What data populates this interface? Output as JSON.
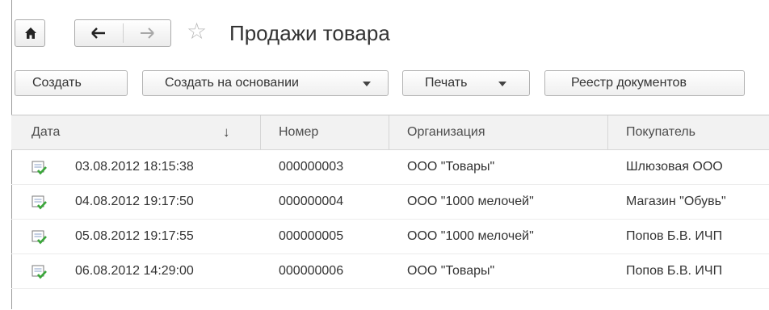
{
  "header": {
    "title": "Продажи товара",
    "home_icon": "home-icon",
    "back_icon": "arrow-left-icon",
    "forward_icon": "arrow-right-icon",
    "favorite_icon": "star-outline-icon"
  },
  "toolbar": {
    "create": "Создать",
    "create_based_on": "Создать на основании",
    "print": "Печать",
    "register": "Реестр документов"
  },
  "table": {
    "columns": [
      "Дата",
      "Номер",
      "Организация",
      "Покупатель"
    ],
    "sort_indicator": "↓",
    "rows": [
      {
        "date": "03.08.2012 18:15:38",
        "number": "000000003",
        "org": "ООО \"Товары\"",
        "buyer": "Шлюзовая ООО"
      },
      {
        "date": "04.08.2012 19:17:50",
        "number": "000000004",
        "org": "ООО \"1000 мелочей\"",
        "buyer": "Магазин \"Обувь\""
      },
      {
        "date": "05.08.2012 19:17:55",
        "number": "000000005",
        "org": "ООО \"1000 мелочей\"",
        "buyer": "Попов Б.В. ИЧП"
      },
      {
        "date": "06.08.2012 14:29:00",
        "number": "000000006",
        "org": "ООО \"Товары\"",
        "buyer": "Попов Б.В. ИЧП"
      }
    ]
  },
  "colors": {
    "doc_icon_green": "#3aa63a",
    "border": "#a9a9a9"
  }
}
